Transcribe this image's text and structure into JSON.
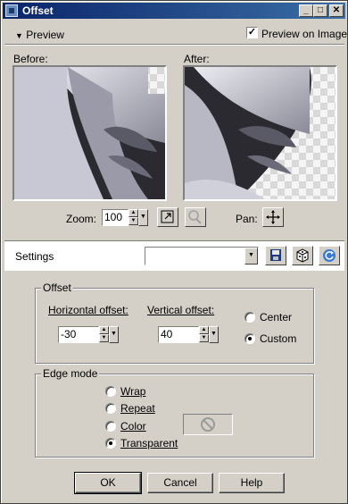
{
  "window": {
    "title": "Offset"
  },
  "titlebar_buttons": {
    "minimize": "_",
    "maximize": "□",
    "close": "✕"
  },
  "preview": {
    "toggle_label": "Preview",
    "preview_on_image_label": "Preview on Image",
    "preview_on_image_checked": true,
    "before_label": "Before:",
    "after_label": "After:"
  },
  "zoom": {
    "label": "Zoom:",
    "value": "100"
  },
  "pan": {
    "label": "Pan:"
  },
  "settings": {
    "label": "Settings",
    "value": ""
  },
  "offset": {
    "group_title": "Offset",
    "horizontal_label": "Horizontal offset:",
    "horizontal_value": "-30",
    "vertical_label": "Vertical offset:",
    "vertical_value": "40",
    "center_label": "Center",
    "custom_label": "Custom",
    "selected": "custom"
  },
  "edge_mode": {
    "group_title": "Edge mode",
    "options": [
      "Wrap",
      "Repeat",
      "Color",
      "Transparent"
    ],
    "selected": "Transparent"
  },
  "buttons": {
    "ok": "OK",
    "cancel": "Cancel",
    "help": "Help"
  }
}
